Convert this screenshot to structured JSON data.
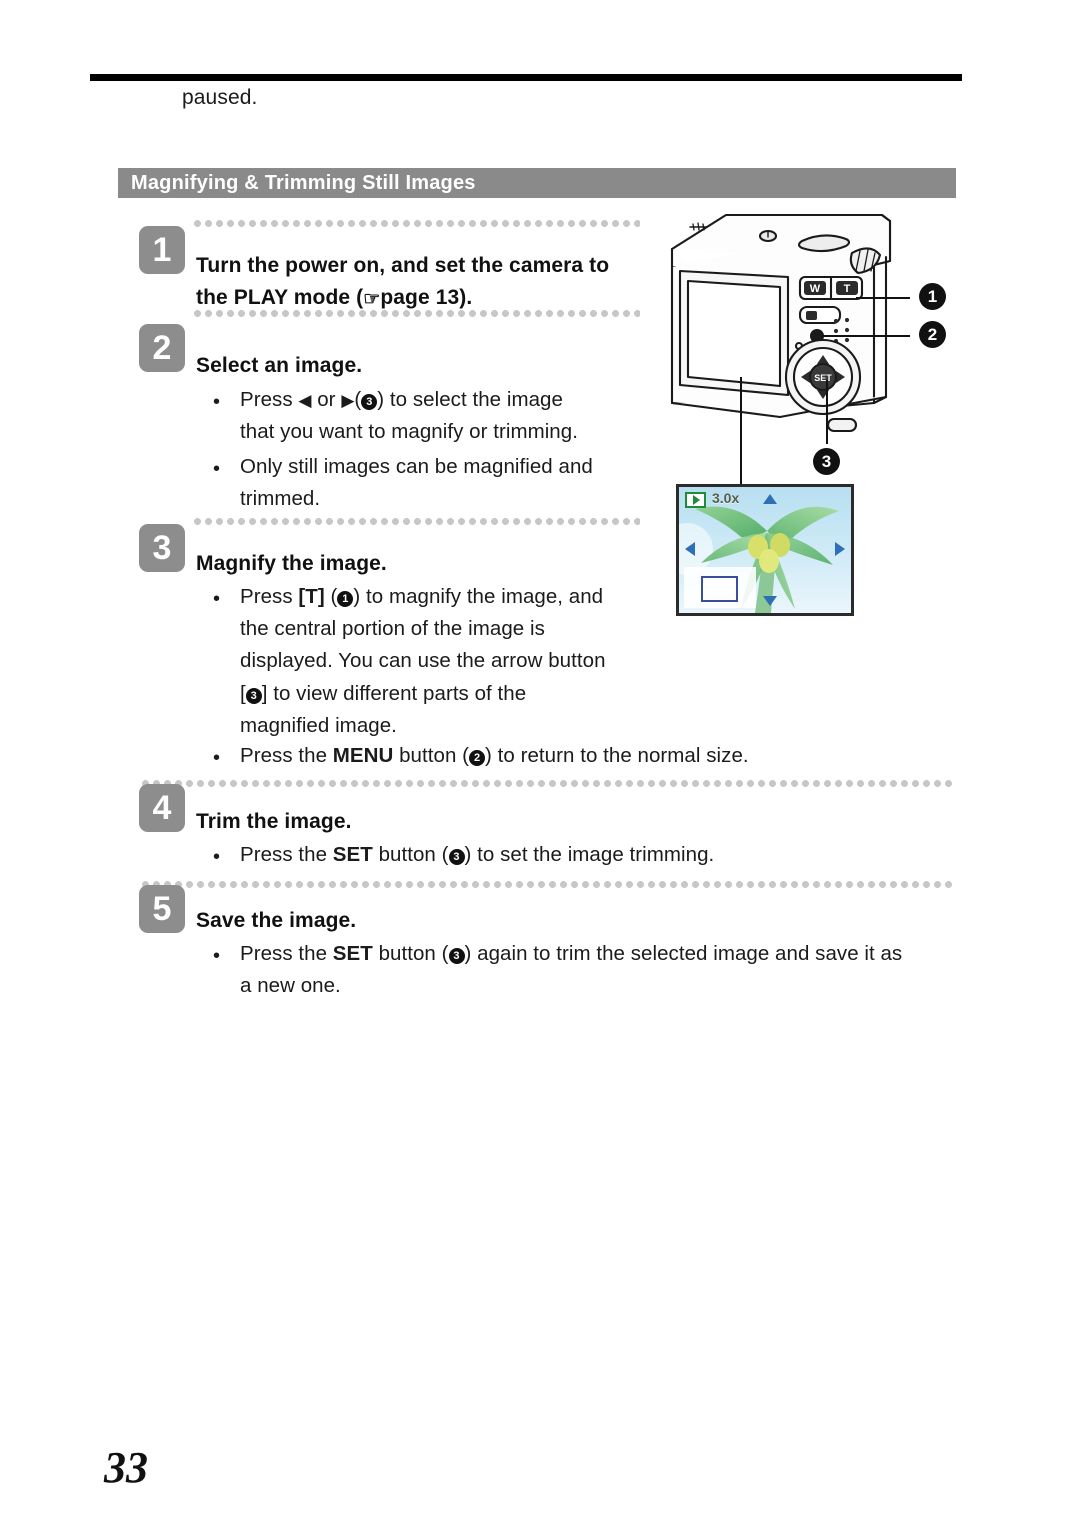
{
  "page": {
    "number": "33",
    "carryover_text": "paused."
  },
  "section": {
    "title": "Magnifying & Trimming Still Images"
  },
  "steps": [
    {
      "number": "1",
      "title_lines": [
        "Turn the power on, and set the camera to",
        "the PLAY mode ("
      ],
      "title_suffix": "page 13).",
      "hand_icon": "☞",
      "bullets": []
    },
    {
      "number": "2",
      "title": "Select an image.",
      "bullets": [
        [
          "Press ",
          "◀",
          " or ",
          "▶",
          "(",
          "3",
          ") to select the image",
          "that you want to magnify or trimming."
        ],
        [
          "Only still images can be magnified and",
          "trimmed."
        ]
      ]
    },
    {
      "number": "3",
      "title": "Magnify the image.",
      "bullets": [
        [
          "Press [T] (",
          "1",
          ") to magnify the image, and",
          "the central portion of the image is",
          "displayed. You can use the arrow button",
          "[",
          "3",
          "] to view different parts of the",
          "magnified image."
        ],
        [
          "Press the MENU button (",
          "2",
          ") to return to the normal size."
        ]
      ]
    },
    {
      "number": "4",
      "title": "Trim the image.",
      "bullets": [
        [
          "Press the SET button (",
          "3",
          ") to set the image trimming."
        ]
      ]
    },
    {
      "number": "5",
      "title": "Save the image.",
      "bullets": [
        [
          "Press the SET button (",
          "3",
          ") again to trim the selected image and save it as",
          "a new one."
        ]
      ]
    }
  ],
  "text": {
    "step1_line1": "Turn the power on, and set the camera to",
    "step1_line2_a": "the PLAY mode (",
    "step1_line2_hand": "☞",
    "step1_line2_b": "page 13).",
    "step2_title": "Select an image.",
    "s2_b1_l1_a": "Press",
    "s2_b1_l1_arrow_left": "◀",
    "s2_b1_l1_or": "or",
    "s2_b1_l1_arrow_right": "▶",
    "s2_b1_l1_open": "(",
    "s2_b1_l1_num": "3",
    "s2_b1_l1_rest": ") to select the image",
    "s2_b1_l2": "that you want to magnify or trimming.",
    "s2_b2_l1": "Only still images can be magnified and",
    "s2_b2_l2": "trimmed.",
    "step3_title": "Magnify the image.",
    "s3_b1_l1_a": "Press",
    "s3_b1_l1_key": "[T]",
    "s3_b1_l1_open": "(",
    "s3_b1_l1_num": "1",
    "s3_b1_l1_rest": ") to magnify the image, and",
    "s3_b1_l2": "the central portion of the image is",
    "s3_b1_l3": "displayed. You can use the arrow button",
    "s3_b1_l4_open": "[",
    "s3_b1_l4_num": "3",
    "s3_b1_l4_rest": "] to view different parts of the",
    "s3_b1_l5": "magnified image.",
    "s3_b2_a": "Press the",
    "s3_b2_key": "MENU",
    "s3_b2_mid": "button (",
    "s3_b2_num": "2",
    "s3_b2_rest": ") to return to the normal size.",
    "step4_title": "Trim the image.",
    "s4_b1_a": "Press the",
    "s4_b1_key": "SET",
    "s4_b1_mid": "button (",
    "s4_b1_num": "3",
    "s4_b1_rest": ") to set the image trimming.",
    "step5_title": "Save the image.",
    "s5_b1_a": "Press the",
    "s5_b1_key": "SET",
    "s5_b1_mid": "button (",
    "s5_b1_num": "3",
    "s5_b1_rest": ") again to trim the selected image and save it as",
    "s5_b1_l2": "a new one.",
    "bullet_glyph": "•"
  },
  "illustration": {
    "callouts": [
      {
        "id": "1",
        "label": "1",
        "target": "zoom-T-button"
      },
      {
        "id": "2",
        "label": "2",
        "target": "menu-button"
      },
      {
        "id": "3",
        "label": "3",
        "target": "arrow-set-button"
      }
    ],
    "lcd": {
      "zoom_level": "3.0x",
      "play_icon": "play-mode-icon",
      "nav_arrows": [
        "up",
        "down",
        "left",
        "right"
      ],
      "thumbnail": "crop-position-indicator"
    }
  },
  "colors": {
    "section_bar": "#8a8a8a",
    "step_box": "#8d8d8d",
    "dotted_rule": "#c7c7c7",
    "rule": "#000000",
    "lcd_accent": "#2f6fb5",
    "play_icon_green": "#1f8a3a"
  }
}
